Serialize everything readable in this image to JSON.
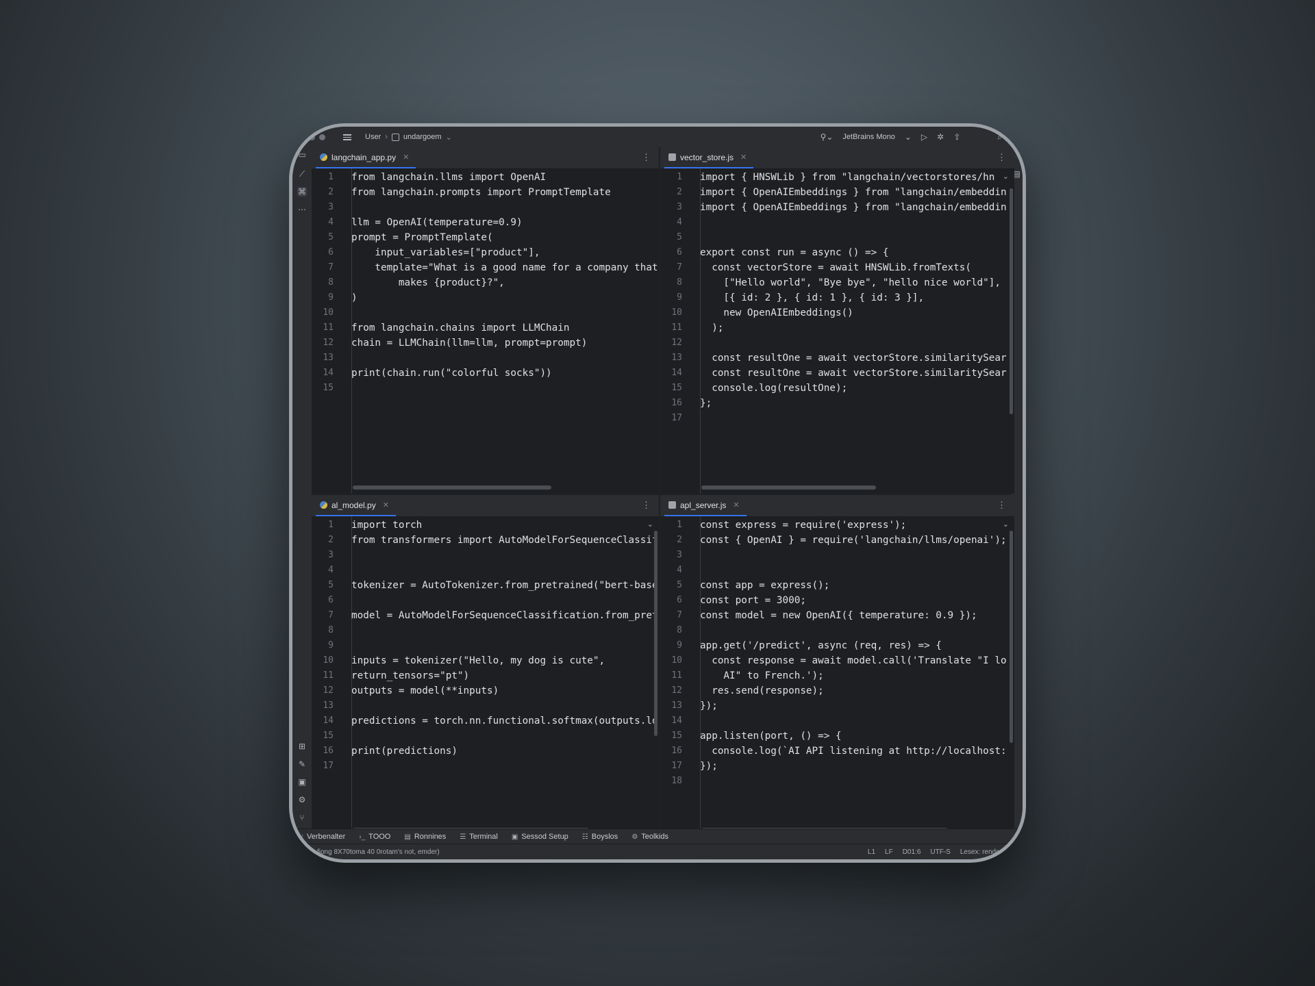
{
  "topbar": {
    "user": "User",
    "project": "undargoem",
    "font_selector": "JetBrains Mono"
  },
  "panes": [
    {
      "tab": "langchain_app.py",
      "icon": "python-file-icon",
      "lines": [
        "from langchain.llms import OpenAI",
        "from langchain.prompts import PromptTemplate",
        "",
        "llm = OpenAI(temperature=0.9)",
        "prompt = PromptTemplate(",
        "    input_variables=[\"product\"],",
        "    template=\"What is a good name for a company that",
        "        makes {product}?\",",
        ")",
        "",
        "from langchain.chains import LLMChain",
        "chain = LLMChain(llm=llm, prompt=prompt)",
        "",
        "print(chain.run(\"colorful socks\"))",
        ""
      ],
      "numbers": [
        "1",
        "2",
        "3",
        "4",
        "5",
        "6",
        "7",
        "8",
        "9",
        "10",
        "11",
        "12",
        "13",
        "14",
        "15"
      ]
    },
    {
      "tab": "vector_store.js",
      "icon": "js-file-icon",
      "lines": [
        "import { HNSWLib } from \"langchain/vectorstores/hn",
        "import { OpenAIEmbeddings } from \"langchain/embeddin",
        "import { OpenAIEmbeddings } from \"langchain/embeddin",
        "",
        "",
        "export const run = async () => {",
        "  const vectorStore = await HNSWLib.fromTexts(",
        "    [\"Hello world\", \"Bye bye\", \"hello nice world\"],",
        "    [{ id: 2 }, { id: 1 }, { id: 3 }],",
        "    new OpenAIEmbeddings()",
        "  );",
        "",
        "  const resultOne = await vectorStore.similaritySear",
        "  const resultOne = await vectorStore.similaritySear",
        "  console.log(resultOne);",
        "};",
        ""
      ],
      "numbers": [
        "1",
        "2",
        "3",
        "4",
        "5",
        "6",
        "7",
        "8",
        "9",
        "10",
        "11",
        "12",
        "13",
        "14",
        "15",
        "16",
        "17"
      ]
    },
    {
      "tab": "al_model.py",
      "icon": "python-file-icon",
      "lines": [
        "import torch",
        "from transformers import AutoModelForSequenceClassifi",
        "",
        "",
        "tokenizer = AutoTokenizer.from_pretrained(\"bert-base",
        "",
        "model = AutoModelForSequenceClassification.from_pretr",
        "",
        "",
        "inputs = tokenizer(\"Hello, my dog is cute\",",
        "return_tensors=\"pt\")",
        "outputs = model(**inputs)",
        "",
        "predictions = torch.nn.functional.softmax(outputs.lo",
        "",
        "print(predictions)",
        ""
      ],
      "numbers": [
        "1",
        "2",
        "3",
        "4",
        "5",
        "6",
        "7",
        "8",
        "9",
        "10",
        "11",
        "12",
        "13",
        "14",
        "15",
        "16",
        "17"
      ]
    },
    {
      "tab": "apl_server.js",
      "icon": "js-file-icon",
      "lines": [
        "const express = require('express');",
        "const { OpenAI } = require('langchain/llms/openai');",
        "",
        "",
        "const app = express();",
        "const port = 3000;",
        "const model = new OpenAI({ temperature: 0.9 });",
        "",
        "app.get('/predict', async (req, res) => {",
        "  const response = await model.call('Translate \"I lo",
        "    AI\" to French.');",
        "  res.send(response);",
        "});",
        "",
        "app.listen(port, () => {",
        "  console.log(`AI API listening at http://localhost:",
        "});",
        ""
      ],
      "numbers": [
        "1",
        "2",
        "3",
        "4",
        "5",
        "6",
        "7",
        "8",
        "9",
        "10",
        "11",
        "12",
        "13",
        "14",
        "15",
        "16",
        "17",
        "18"
      ]
    }
  ],
  "bottom_tabs": [
    {
      "label": "Verbenalter",
      "icon": "version-control-icon"
    },
    {
      "label": "TOOO",
      "icon": "terminal-prompt-icon"
    },
    {
      "label": "Ronnines",
      "icon": "run-icon"
    },
    {
      "label": "Terminal",
      "icon": "terminal-icon"
    },
    {
      "label": "Sessod Setup",
      "icon": "session-icon"
    },
    {
      "label": "Boyslos",
      "icon": "problems-icon"
    },
    {
      "label": "Teolkids",
      "icon": "tools-icon"
    }
  ],
  "status": {
    "message": "fiong 8X70toma 40 0rotam's not, emder)",
    "items": [
      "L1",
      "LF",
      "D01:6",
      "UTF-S",
      "Lesex: render"
    ]
  }
}
